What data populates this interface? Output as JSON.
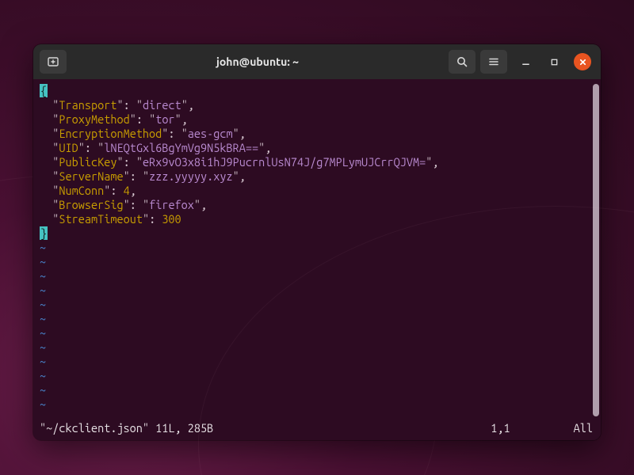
{
  "titlebar": {
    "title": "john@ubuntu: ~"
  },
  "editor": {
    "open_brace": "{",
    "close_brace": "}",
    "entries": [
      {
        "key": "Transport",
        "value": "direct",
        "type": "string",
        "trailing_comma": true
      },
      {
        "key": "ProxyMethod",
        "value": "tor",
        "type": "string",
        "trailing_comma": true
      },
      {
        "key": "EncryptionMethod",
        "value": "aes-gcm",
        "type": "string",
        "trailing_comma": true
      },
      {
        "key": "UID",
        "value": "lNEQtGxl6BgYmVg9N5kBRA==",
        "type": "string",
        "trailing_comma": true
      },
      {
        "key": "PublicKey",
        "value": "eRx9vO3x8i1hJ9PucrnlUsN74J/g7MPLymUJCrrQJVM=",
        "type": "string",
        "trailing_comma": true
      },
      {
        "key": "ServerName",
        "value": "zzz.yyyyy.xyz",
        "type": "string",
        "trailing_comma": true
      },
      {
        "key": "NumConn",
        "value": "4",
        "type": "number",
        "trailing_comma": true
      },
      {
        "key": "BrowserSig",
        "value": "firefox",
        "type": "string",
        "trailing_comma": true
      },
      {
        "key": "StreamTimeout",
        "value": "300",
        "type": "number",
        "trailing_comma": false
      }
    ],
    "tilde_count": 12,
    "tilde_char": "~"
  },
  "status": {
    "left": "\"~/ckclient.json\" 11L, 285B",
    "position": "1,1",
    "percent": "All"
  }
}
